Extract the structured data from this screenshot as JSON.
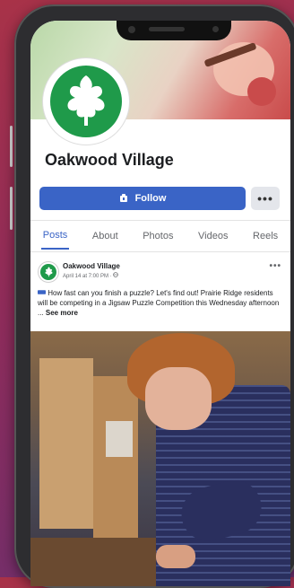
{
  "page": {
    "name": "Oakwood Village",
    "follow_label": "Follow",
    "more_label": "•••"
  },
  "tabs": [
    {
      "label": "Posts",
      "active": true
    },
    {
      "label": "About",
      "active": false
    },
    {
      "label": "Photos",
      "active": false
    },
    {
      "label": "Videos",
      "active": false
    },
    {
      "label": "Reels",
      "active": false
    }
  ],
  "post": {
    "author": "Oakwood Village",
    "meta": "April 14 at 7:00 PM ·",
    "text": "How fast can you finish a puzzle? Let's find out! Prairie Ridge residents will be competing in a Jigsaw Puzzle Competition this Wednesday afternoon ... ",
    "see_more": "See more",
    "dots": "•••"
  },
  "colors": {
    "accent": "#3a64c6",
    "brand_green": "#1f9a4a"
  }
}
